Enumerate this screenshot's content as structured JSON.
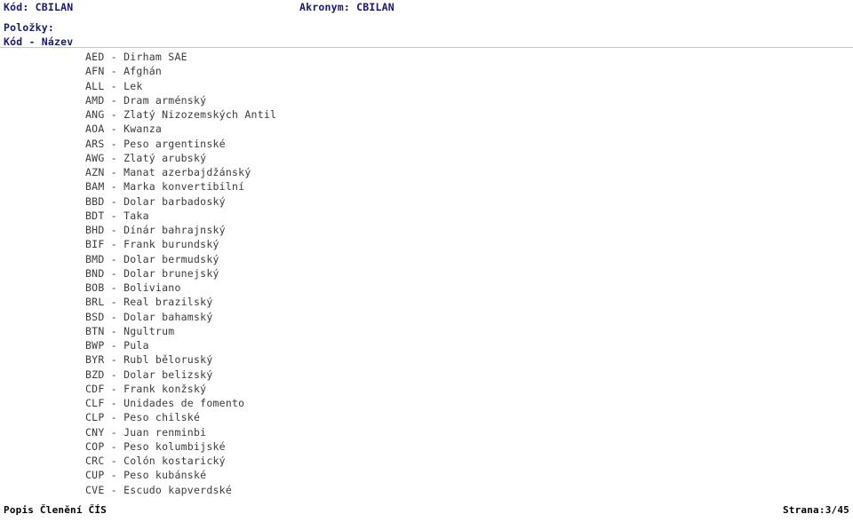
{
  "header": {
    "code_line": "Kód: CBILAN",
    "acronym_line": "Akronym: CBILAN",
    "section_label": "Položky:",
    "column_head": "Kód - Název",
    "accent_color": "#191970"
  },
  "items": [
    {
      "code": "AED",
      "sep": " - ",
      "name": "Dirham SAE"
    },
    {
      "code": "AFN",
      "sep": " - ",
      "name": "Afghán"
    },
    {
      "code": "ALL",
      "sep": " - ",
      "name": "Lek"
    },
    {
      "code": "AMD",
      "sep": " - ",
      "name": "Dram arménský"
    },
    {
      "code": "ANG",
      "sep": " - ",
      "name": "Zlatý Nizozemských Antil"
    },
    {
      "code": "AOA",
      "sep": " - ",
      "name": "Kwanza"
    },
    {
      "code": "ARS",
      "sep": " - ",
      "name": "Peso argentinské"
    },
    {
      "code": "AWG",
      "sep": " - ",
      "name": "Zlatý arubský"
    },
    {
      "code": "AZN",
      "sep": " - ",
      "name": "Manat azerbajdžánský"
    },
    {
      "code": "BAM",
      "sep": " - ",
      "name": "Marka konvertibilní"
    },
    {
      "code": "BBD",
      "sep": " - ",
      "name": "Dolar barbadoský"
    },
    {
      "code": "BDT",
      "sep": " - ",
      "name": "Taka"
    },
    {
      "code": "BHD",
      "sep": " - ",
      "name": "Dínár bahrajnský"
    },
    {
      "code": "BIF",
      "sep": " - ",
      "name": "Frank burundský"
    },
    {
      "code": "BMD",
      "sep": " - ",
      "name": "Dolar bermudský"
    },
    {
      "code": "BND",
      "sep": " - ",
      "name": "Dolar brunejský"
    },
    {
      "code": "BOB",
      "sep": " - ",
      "name": "Boliviano"
    },
    {
      "code": "BRL",
      "sep": " - ",
      "name": "Real brazilský"
    },
    {
      "code": "BSD",
      "sep": " - ",
      "name": "Dolar bahamský"
    },
    {
      "code": "BTN",
      "sep": " - ",
      "name": "Ngultrum"
    },
    {
      "code": "BWP",
      "sep": " - ",
      "name": "Pula"
    },
    {
      "code": "BYR",
      "sep": " - ",
      "name": "Rubl běloruský"
    },
    {
      "code": "BZD",
      "sep": " - ",
      "name": "Dolar belizský"
    },
    {
      "code": "CDF",
      "sep": " - ",
      "name": "Frank konžský"
    },
    {
      "code": "CLF",
      "sep": " - ",
      "name": "Unidades de fomento"
    },
    {
      "code": "CLP",
      "sep": " - ",
      "name": "Peso chilské"
    },
    {
      "code": "CNY",
      "sep": " - ",
      "name": "Juan renminbi"
    },
    {
      "code": "COP",
      "sep": " - ",
      "name": "Peso kolumbijské"
    },
    {
      "code": "CRC",
      "sep": " - ",
      "name": "Colón kostarický"
    },
    {
      "code": "CUP",
      "sep": " - ",
      "name": "Peso kubánské"
    },
    {
      "code": "CVE",
      "sep": " - ",
      "name": "Escudo kapverdské"
    }
  ],
  "footer": {
    "left": "Popis Členění ČÍS",
    "right": "Strana:3/45"
  }
}
